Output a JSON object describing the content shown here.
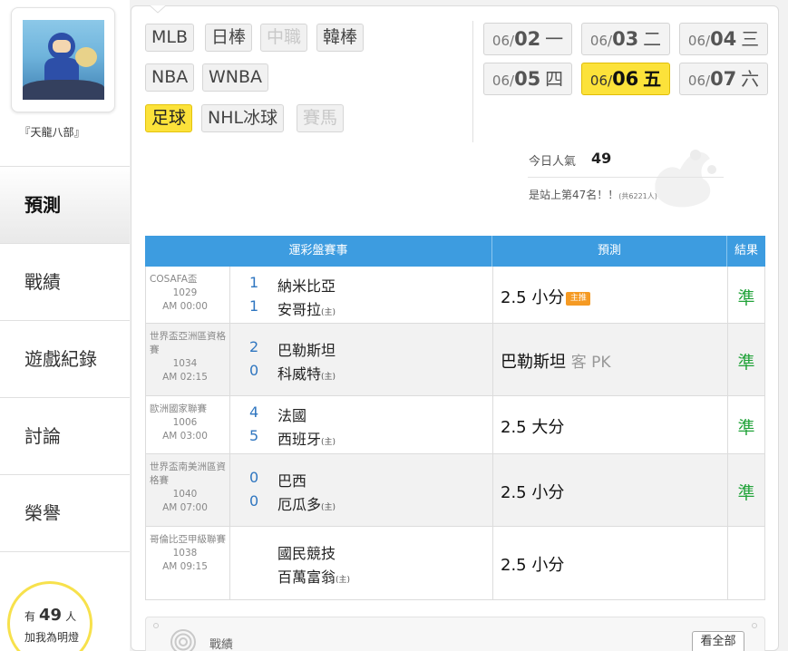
{
  "user": {
    "name": "『天龍八部』"
  },
  "nav": [
    {
      "label": "預測",
      "active": true
    },
    {
      "label": "戰績",
      "active": false
    },
    {
      "label": "遊戲紀錄",
      "active": false
    },
    {
      "label": "討論",
      "active": false
    },
    {
      "label": "榮譽",
      "active": false
    }
  ],
  "lamp": {
    "prefix": "有",
    "count": "49",
    "suffix": "人",
    "text": "加我為明燈"
  },
  "sports": {
    "row1": [
      {
        "label": "MLB",
        "state": "normal"
      },
      {
        "label": "日棒",
        "state": "normal"
      },
      {
        "label": "中職",
        "state": "disabled"
      },
      {
        "label": "韓棒",
        "state": "normal"
      }
    ],
    "row2": [
      {
        "label": "NBA",
        "state": "normal"
      },
      {
        "label": "WNBA",
        "state": "normal"
      }
    ],
    "row3": [
      {
        "label": "足球",
        "state": "active"
      },
      {
        "label": "NHL冰球",
        "state": "normal"
      },
      {
        "label": "賽馬",
        "state": "disabled"
      }
    ]
  },
  "dates": [
    {
      "month": "06/",
      "day": "02",
      "weekday": "一",
      "active": false
    },
    {
      "month": "06/",
      "day": "03",
      "weekday": "二",
      "active": false
    },
    {
      "month": "06/",
      "day": "04",
      "weekday": "三",
      "active": false
    },
    {
      "month": "06/",
      "day": "05",
      "weekday": "四",
      "active": false
    },
    {
      "month": "06/",
      "day": "06",
      "weekday": "五",
      "active": true
    },
    {
      "month": "06/",
      "day": "07",
      "weekday": "六",
      "active": false
    }
  ],
  "popularity": {
    "label": "今日人氣",
    "value": "49",
    "rank_text": "是站上第47名！！",
    "rank_total": "(共6221人)"
  },
  "table": {
    "headers": {
      "event": "運彩盤賽事",
      "prediction": "預測",
      "result": "結果"
    },
    "rows": [
      {
        "league": "COSAFA盃",
        "code": "1029",
        "time": "AM 00:00",
        "score_away": "1",
        "score_home": "1",
        "away": "納米比亞",
        "home": "安哥拉",
        "home_tag": "(主)",
        "prediction": "2.5 小分",
        "prediction_extra": "",
        "badge": "主推",
        "result": "準"
      },
      {
        "league": "世界盃亞洲區資格賽",
        "code": "1034",
        "time": "AM 02:15",
        "score_away": "2",
        "score_home": "0",
        "away": "巴勒斯坦",
        "home": "科威特",
        "home_tag": "(主)",
        "prediction": "巴勒斯坦",
        "prediction_extra": "客 PK",
        "badge": "",
        "result": "準"
      },
      {
        "league": "歐洲國家聯賽",
        "code": "1006",
        "time": "AM 03:00",
        "score_away": "4",
        "score_home": "5",
        "away": "法國",
        "home": "西班牙",
        "home_tag": "(主)",
        "prediction": "2.5 大分",
        "prediction_extra": "",
        "badge": "",
        "result": "準"
      },
      {
        "league": "世界盃南美洲區資格賽",
        "code": "1040",
        "time": "AM 07:00",
        "score_away": "0",
        "score_home": "0",
        "away": "巴西",
        "home": "厄瓜多",
        "home_tag": "(主)",
        "prediction": "2.5 小分",
        "prediction_extra": "",
        "badge": "",
        "result": "準"
      },
      {
        "league": "哥倫比亞甲級聯賽",
        "code": "1038",
        "time": "AM 09:15",
        "score_away": "",
        "score_home": "",
        "away": "國民競技",
        "home": "百萬富翁",
        "home_tag": "(主)",
        "prediction": "2.5 小分",
        "prediction_extra": "",
        "badge": "",
        "result": ""
      }
    ]
  },
  "stats_box": {
    "label": "戰績",
    "button": "看全部"
  },
  "colors": {
    "accent_blue": "#3d9ce0",
    "active_yellow": "#fce23a",
    "result_green": "#22a33a",
    "badge_orange": "#f59a23"
  }
}
